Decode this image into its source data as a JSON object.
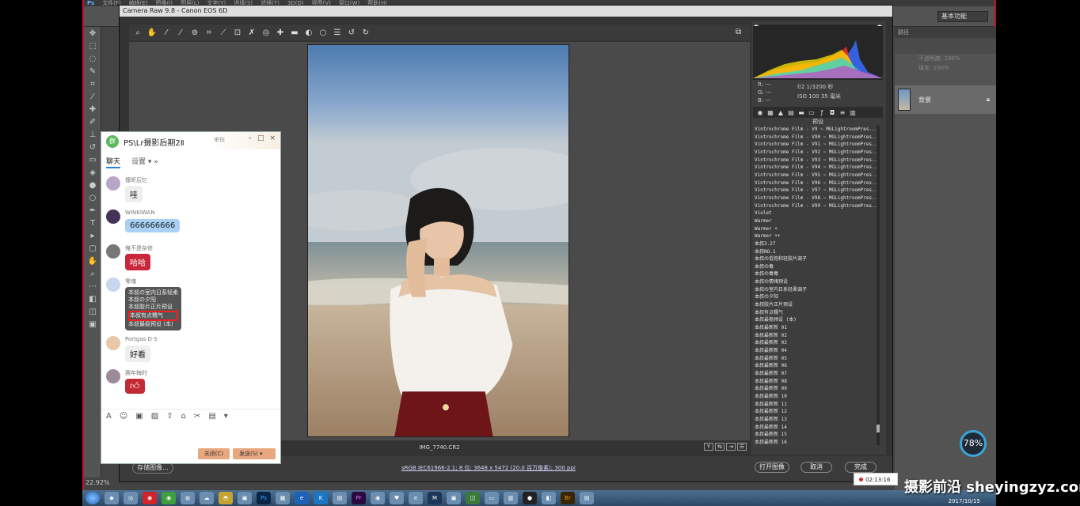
{
  "photoshop": {
    "menu": [
      "文件(F)",
      "编辑(E)",
      "图像(I)",
      "图层(L)",
      "文字(Y)",
      "选择(S)",
      "滤镜(T)",
      "3D(D)",
      "视图(V)",
      "窗口(W)",
      "帮助(H)"
    ],
    "workspace": "基本功能",
    "zoom": "22.92%",
    "layer_name": "背景",
    "panel_title": "路径",
    "opacity_label": "不透明度: 100%",
    "fill_label": "填充: 100%"
  },
  "camera_raw": {
    "title": "Camera Raw 9.8  -  Canon EOS 6D",
    "filename": "IMG_7740.CR2",
    "exif": {
      "r": "R:  ---",
      "g": "G:  ---",
      "b": "B:  ---",
      "aperture_shutter": "f/2    1/3200 秒",
      "iso_lens": "ISO 100    35 毫米"
    },
    "presets_title": "预设",
    "presets": [
      "Vintrochrome Film - V9 ~ MGLightroomPres...",
      "Vintrochrome Film - V90 ~ MGLightroomPres...",
      "Vintrochrome Film - V91 ~ MGLightroomPres...",
      "Vintrochrome Film - V92 ~ MGLightroomPres...",
      "Vintrochrome Film - V93 ~ MGLightroomPres...",
      "Vintrochrome Film - V94 ~ MGLightroomPres...",
      "Vintrochrome Film - V95 ~ MGLightroomPres...",
      "Vintrochrome Film - V96 ~ MGLightroomPres...",
      "Vintrochrome Film - V97 ~ MGLightroomPres...",
      "Vintrochrome Film - V98 ~ MGLightroomPres...",
      "Vintrochrome Film - V99 ~ MGLightroomPres...",
      "Violet",
      "Warmer",
      "Warmer +",
      "Warmer ++",
      "本叔3.27",
      "本叔NO.1",
      "本叔の低饱和轻胶片调子",
      "本叔の毒",
      "本叔の毒毒",
      "本叔の情绪预设",
      "本叔の室内日系轻柔调子",
      "本叔の夕阳",
      "本叔胶片正片预设",
      "本叔有点糯气",
      "本叔最稳预设 (本)",
      "本叔最新新 01",
      "本叔最新新 02",
      "本叔最新新 03",
      "本叔最新新 04",
      "本叔最新新 05",
      "本叔最新新 06",
      "本叔最新新 07",
      "本叔最新新 08",
      "本叔最新新 09",
      "本叔最新新 10",
      "本叔最新新 11",
      "本叔最新新 12",
      "本叔最新新 13",
      "本叔最新新 14",
      "本叔最新新 15",
      "本叔最新新 16"
    ],
    "workflow_link": "sRGB IEC61966-2.1; 8 位; 3648 x 5472 (20.0 百万像素); 300 ppi",
    "save_button": "存储图像...",
    "open_button": "打开图像",
    "cancel_button": "取消",
    "done_button": "完成"
  },
  "qq": {
    "title": "PS\\Lr摄影后期2Ⅱ",
    "tag": "审核",
    "tabs": {
      "chat": "聊天",
      "settings": "设置"
    },
    "messages": [
      {
        "name": "撞昕后忆",
        "text": "哇"
      },
      {
        "name": "WINKIWAN",
        "text": "666666666"
      },
      {
        "name": "俺不是杂修",
        "text": "哈哈"
      },
      {
        "name": "零魂",
        "text": ""
      },
      {
        "name": "Portgas·D·S",
        "text": "好看"
      },
      {
        "name": "赛年梅时",
        "text": ""
      }
    ],
    "shared_preset_lines": [
      "本叔の室内日系轻柔",
      "本叔の夕阳",
      "本叔胶片正片预设",
      "本叔有点糯气",
      "本叔最稳预设 (本)"
    ],
    "close_button": "关闭(C)",
    "send_button": "发送(S)"
  },
  "overlay": {
    "timer_percent": "78%",
    "recording_time": "02:13:16",
    "watermark": "摄影前沿 sheyingzyz.com",
    "date": "2017/10/15"
  },
  "colors": {
    "ps_bg": "#434343",
    "cr_bg": "#333333",
    "accent_red": "#c8102e",
    "qq_blue": "#2a7de1"
  }
}
